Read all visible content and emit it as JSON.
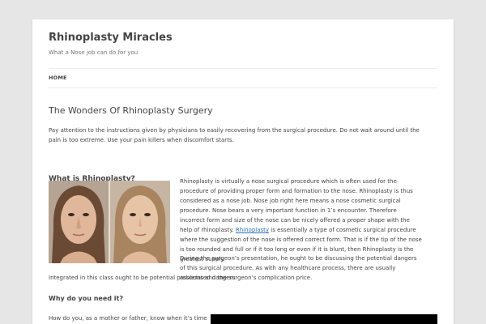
{
  "site": {
    "title": "Rhinoplasty Miracles",
    "description": "What a Nose job can do for you"
  },
  "nav": {
    "items": [
      {
        "label": "HOME"
      }
    ]
  },
  "post": {
    "title": "The Wonders Of Rhinoplasty Surgery",
    "intro": "Pay attention to the instructions given by physicians to easily recovering from the surgical procedure. Do not wait around until the pain is too extreme. Use your pain killers when discomfort starts.",
    "section1_heading": "What is Rhinoplasty?",
    "para1_before": "Rhinoplasty is virtually a nose surgical procedure which is often used for the procedure of providing proper form and formation to the nose. Rhinoplasty is thus considered as a nose job. Nose job right here means a nose cosmetic surgical procedure. Nose bears a very important function in 1’s encounter. Therefore incorrect form and size of the nose can be nicely offered a proper shape with the help of rhinoplasty. ",
    "para1_link": "Rhinoplasty",
    "para1_after": " is essentially a type of cosmetic surgical procedure where the suggestion of the nose is offered correct form. That is if the tip of the nose is too rounded and full or if it too long or even if it is blunt, then Rhinoplasty is the greatest supply.",
    "para2_top": "During the surgeon’s presentation, he ought to be discussing the potential dangers of this surgical procedure. As with any healthcare process, there are usually associated dangers.",
    "para2_bottom": "Integrated in this class ought to be potential problems and the surgeon’s complication price.",
    "section2_heading": "Why do you need it?",
    "para3": "How do you, as a mother or father, know when it’s time to"
  },
  "colors": {
    "background": "#e6e6e6",
    "page": "#ffffff",
    "text": "#444444",
    "link": "#2a6fb8",
    "video": "#000000"
  }
}
